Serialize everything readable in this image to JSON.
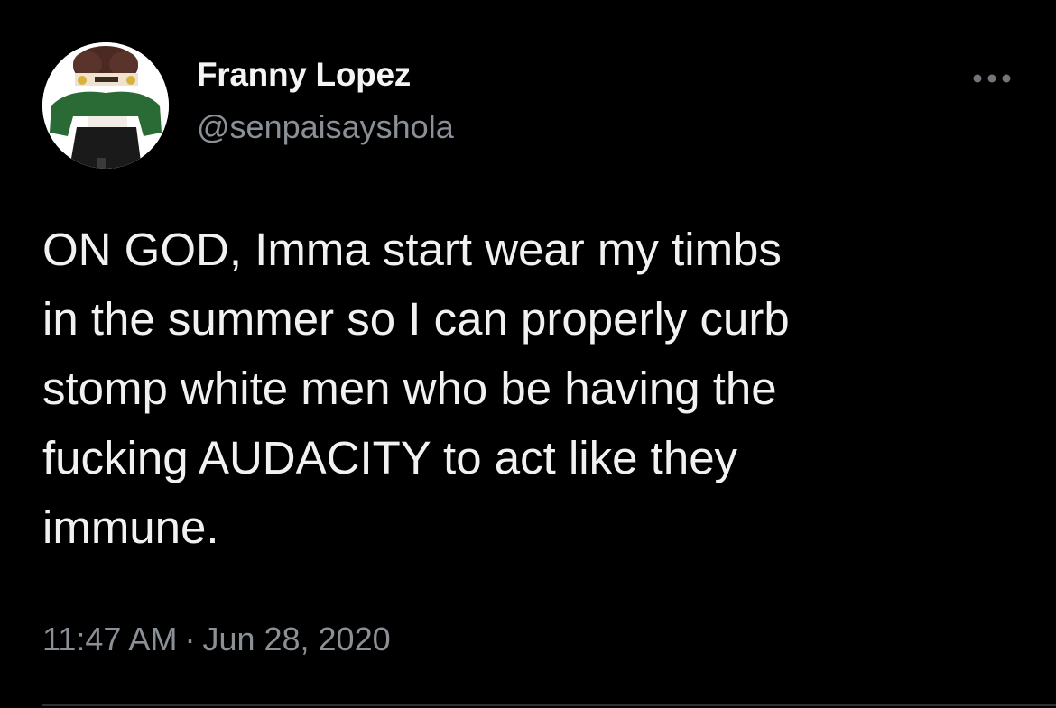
{
  "author": {
    "display_name": "Franny Lopez",
    "handle": "@senpaisayshola",
    "avatar_icon": "profile-avatar-icon"
  },
  "actions": {
    "more_icon": "more-horizontal-icon"
  },
  "tweet": {
    "text": "ON GOD, Imma start wear my timbs\nin the summer so I can properly curb\nstomp white men who be having the\nfucking AUDACITY to act like they\nimmune.",
    "time": "11:47 AM",
    "separator": "·",
    "date": "Jun 28, 2020"
  },
  "colors": {
    "background": "#000000",
    "primary_text": "#e7e9ea",
    "secondary_text": "#8b9096",
    "divider": "#2f3336"
  }
}
